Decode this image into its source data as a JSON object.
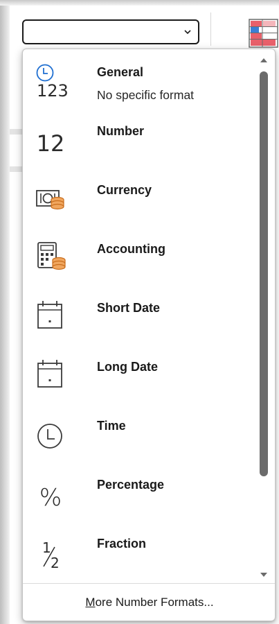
{
  "combo": {
    "value": ""
  },
  "formats": [
    {
      "id": "general",
      "label": "General",
      "description": "No specific format",
      "icon": "clock-123-icon"
    },
    {
      "id": "number",
      "label": "Number",
      "description": "",
      "icon": "number-12-icon",
      "glyph": "12"
    },
    {
      "id": "currency",
      "label": "Currency",
      "description": "",
      "icon": "currency-banknote-coins-icon"
    },
    {
      "id": "accounting",
      "label": "Accounting",
      "description": "",
      "icon": "calculator-coins-icon"
    },
    {
      "id": "short-date",
      "label": "Short Date",
      "description": "",
      "icon": "calendar-short-icon"
    },
    {
      "id": "long-date",
      "label": "Long Date",
      "description": "",
      "icon": "calendar-long-icon"
    },
    {
      "id": "time",
      "label": "Time",
      "description": "",
      "icon": "clock-icon"
    },
    {
      "id": "percentage",
      "label": "Percentage",
      "description": "",
      "icon": "percent-icon",
      "glyph": "%"
    },
    {
      "id": "fraction",
      "label": "Fraction",
      "description": "",
      "icon": "fraction-icon"
    }
  ],
  "general_icon_digits": "123",
  "fraction_glyph": {
    "numerator": "1",
    "denominator": "2"
  },
  "footer": {
    "more_accel": "M",
    "more_rest": "ore Number Formats..."
  },
  "colors": {
    "accent_blue": "#1f6fd1",
    "coin_orange": "#e8893a",
    "icon_gray": "#3a3a3a"
  }
}
